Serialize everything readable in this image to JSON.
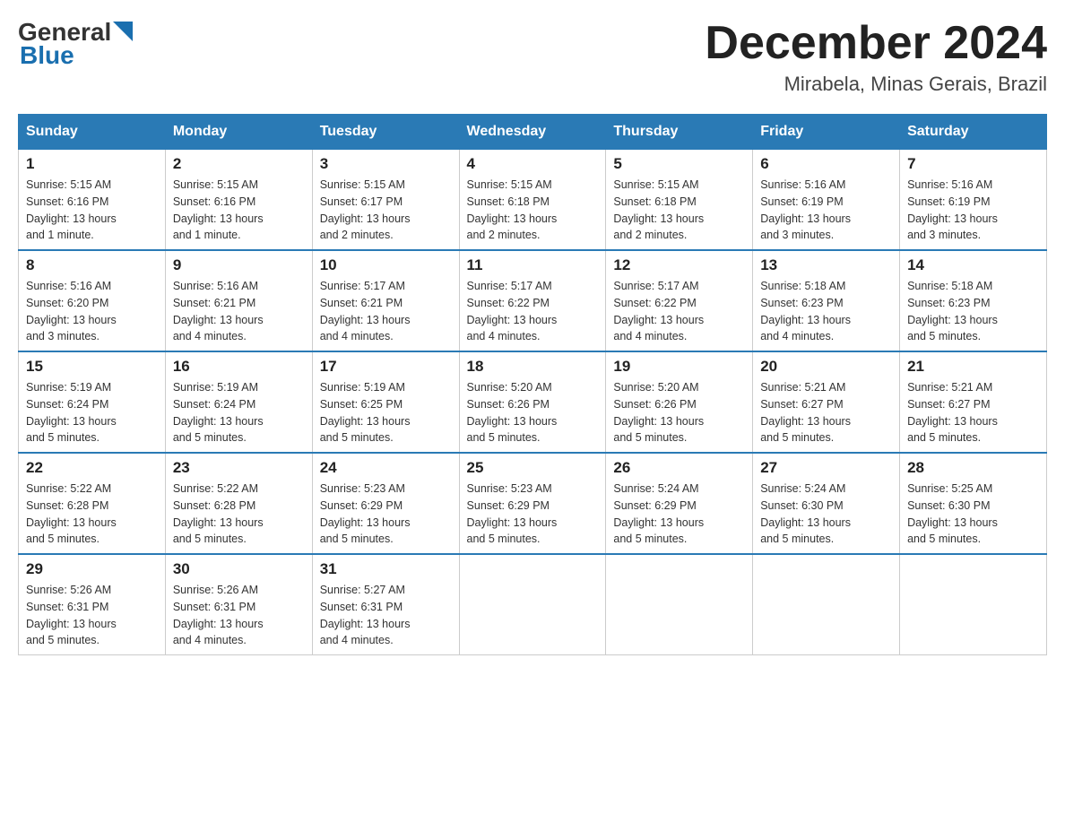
{
  "header": {
    "logo_general": "General",
    "logo_blue": "Blue",
    "title": "December 2024",
    "subtitle": "Mirabela, Minas Gerais, Brazil"
  },
  "days_of_week": [
    "Sunday",
    "Monday",
    "Tuesday",
    "Wednesday",
    "Thursday",
    "Friday",
    "Saturday"
  ],
  "weeks": [
    [
      {
        "day": "1",
        "sunrise": "5:15 AM",
        "sunset": "6:16 PM",
        "daylight": "13 hours and 1 minute."
      },
      {
        "day": "2",
        "sunrise": "5:15 AM",
        "sunset": "6:16 PM",
        "daylight": "13 hours and 1 minute."
      },
      {
        "day": "3",
        "sunrise": "5:15 AM",
        "sunset": "6:17 PM",
        "daylight": "13 hours and 2 minutes."
      },
      {
        "day": "4",
        "sunrise": "5:15 AM",
        "sunset": "6:18 PM",
        "daylight": "13 hours and 2 minutes."
      },
      {
        "day": "5",
        "sunrise": "5:15 AM",
        "sunset": "6:18 PM",
        "daylight": "13 hours and 2 minutes."
      },
      {
        "day": "6",
        "sunrise": "5:16 AM",
        "sunset": "6:19 PM",
        "daylight": "13 hours and 3 minutes."
      },
      {
        "day": "7",
        "sunrise": "5:16 AM",
        "sunset": "6:19 PM",
        "daylight": "13 hours and 3 minutes."
      }
    ],
    [
      {
        "day": "8",
        "sunrise": "5:16 AM",
        "sunset": "6:20 PM",
        "daylight": "13 hours and 3 minutes."
      },
      {
        "day": "9",
        "sunrise": "5:16 AM",
        "sunset": "6:21 PM",
        "daylight": "13 hours and 4 minutes."
      },
      {
        "day": "10",
        "sunrise": "5:17 AM",
        "sunset": "6:21 PM",
        "daylight": "13 hours and 4 minutes."
      },
      {
        "day": "11",
        "sunrise": "5:17 AM",
        "sunset": "6:22 PM",
        "daylight": "13 hours and 4 minutes."
      },
      {
        "day": "12",
        "sunrise": "5:17 AM",
        "sunset": "6:22 PM",
        "daylight": "13 hours and 4 minutes."
      },
      {
        "day": "13",
        "sunrise": "5:18 AM",
        "sunset": "6:23 PM",
        "daylight": "13 hours and 4 minutes."
      },
      {
        "day": "14",
        "sunrise": "5:18 AM",
        "sunset": "6:23 PM",
        "daylight": "13 hours and 5 minutes."
      }
    ],
    [
      {
        "day": "15",
        "sunrise": "5:19 AM",
        "sunset": "6:24 PM",
        "daylight": "13 hours and 5 minutes."
      },
      {
        "day": "16",
        "sunrise": "5:19 AM",
        "sunset": "6:24 PM",
        "daylight": "13 hours and 5 minutes."
      },
      {
        "day": "17",
        "sunrise": "5:19 AM",
        "sunset": "6:25 PM",
        "daylight": "13 hours and 5 minutes."
      },
      {
        "day": "18",
        "sunrise": "5:20 AM",
        "sunset": "6:26 PM",
        "daylight": "13 hours and 5 minutes."
      },
      {
        "day": "19",
        "sunrise": "5:20 AM",
        "sunset": "6:26 PM",
        "daylight": "13 hours and 5 minutes."
      },
      {
        "day": "20",
        "sunrise": "5:21 AM",
        "sunset": "6:27 PM",
        "daylight": "13 hours and 5 minutes."
      },
      {
        "day": "21",
        "sunrise": "5:21 AM",
        "sunset": "6:27 PM",
        "daylight": "13 hours and 5 minutes."
      }
    ],
    [
      {
        "day": "22",
        "sunrise": "5:22 AM",
        "sunset": "6:28 PM",
        "daylight": "13 hours and 5 minutes."
      },
      {
        "day": "23",
        "sunrise": "5:22 AM",
        "sunset": "6:28 PM",
        "daylight": "13 hours and 5 minutes."
      },
      {
        "day": "24",
        "sunrise": "5:23 AM",
        "sunset": "6:29 PM",
        "daylight": "13 hours and 5 minutes."
      },
      {
        "day": "25",
        "sunrise": "5:23 AM",
        "sunset": "6:29 PM",
        "daylight": "13 hours and 5 minutes."
      },
      {
        "day": "26",
        "sunrise": "5:24 AM",
        "sunset": "6:29 PM",
        "daylight": "13 hours and 5 minutes."
      },
      {
        "day": "27",
        "sunrise": "5:24 AM",
        "sunset": "6:30 PM",
        "daylight": "13 hours and 5 minutes."
      },
      {
        "day": "28",
        "sunrise": "5:25 AM",
        "sunset": "6:30 PM",
        "daylight": "13 hours and 5 minutes."
      }
    ],
    [
      {
        "day": "29",
        "sunrise": "5:26 AM",
        "sunset": "6:31 PM",
        "daylight": "13 hours and 5 minutes."
      },
      {
        "day": "30",
        "sunrise": "5:26 AM",
        "sunset": "6:31 PM",
        "daylight": "13 hours and 4 minutes."
      },
      {
        "day": "31",
        "sunrise": "5:27 AM",
        "sunset": "6:31 PM",
        "daylight": "13 hours and 4 minutes."
      },
      null,
      null,
      null,
      null
    ]
  ],
  "labels": {
    "sunrise": "Sunrise:",
    "sunset": "Sunset:",
    "daylight": "Daylight:"
  }
}
